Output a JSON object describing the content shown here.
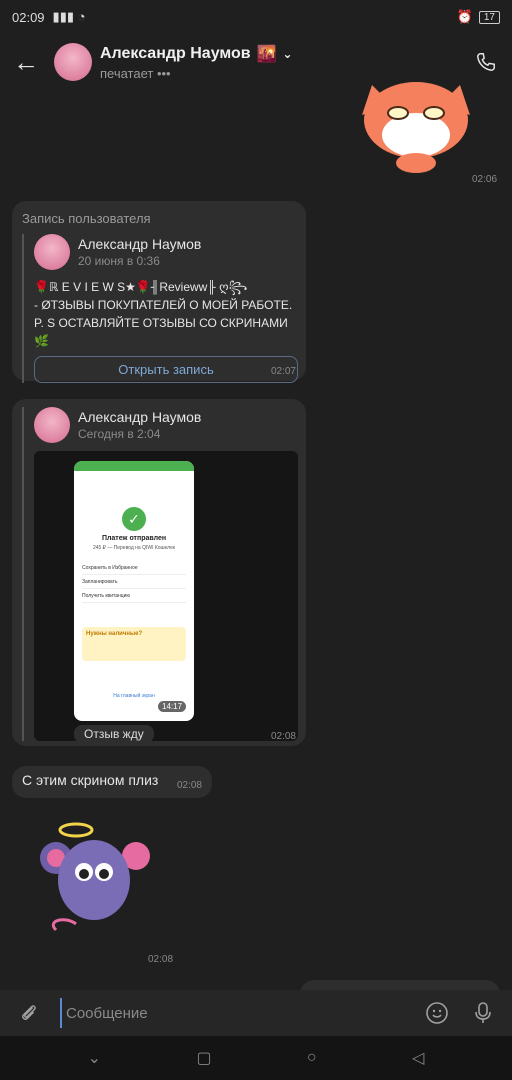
{
  "status": {
    "time": "02:09",
    "battery": "17"
  },
  "header": {
    "title": "Александр Наумов",
    "status_text": "печатает •••"
  },
  "messages": {
    "cat_sticker_time": "02:06",
    "post1": {
      "label": "Запись пользователя",
      "author": "Александр Наумов",
      "date": "20 июня в 0:36",
      "line1": "🌹ℝ E V I E W S★🌹╢Revieww╟ ღ꧂",
      "line2": "- ØТЗЫВЫ ПОКУПАТЕЛЕЙ О МОЕЙ РАБОТЕ.",
      "line3": "P. S ОСТАВЛЯЙТЕ ОТЗЫВЫ СО СКРИНАМИ🌿",
      "button": "Открыть запись",
      "time": "02:07"
    },
    "post2": {
      "author": "Александр Наумов",
      "date": "Сегодня в 2:04",
      "phone": {
        "title": "Платеж отправлен",
        "subtitle": "245 ₽ — Перевод на QIWI Кошелек",
        "items": [
          "Сохранить в Избранное",
          "Запланировать",
          "Получить квитанцию"
        ],
        "promo": "Нужны наличные?",
        "link": "На главный экран",
        "time": "14:17"
      },
      "cut_text": "Отзыв жду",
      "time": "02:08"
    },
    "text_msg": {
      "text": "С этим скрином плиз",
      "time": "02:08"
    },
    "mouse_sticker_time": "02:08"
  },
  "composer": {
    "placeholder": "Сообщение"
  },
  "colors": {
    "accent": "#7fa9d6",
    "bubble": "#2e2e2e",
    "background": "#1f1f1f"
  }
}
